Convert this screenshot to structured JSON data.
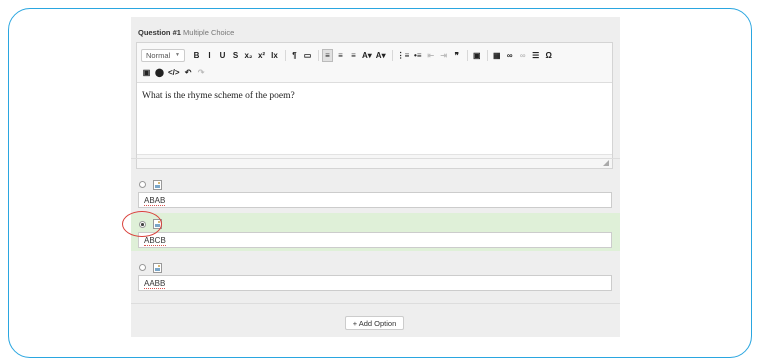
{
  "question": {
    "label": "Question #1",
    "type": "Multiple Choice"
  },
  "toolbar": {
    "format": "Normal",
    "row1": [
      {
        "name": "bold-button",
        "glyph": "B"
      },
      {
        "name": "italic-button",
        "glyph": "I"
      },
      {
        "name": "underline-button",
        "glyph": "U"
      },
      {
        "name": "strikethrough-button",
        "glyph": "S"
      },
      {
        "name": "subscript-button",
        "glyph": "x₂"
      },
      {
        "name": "superscript-button",
        "glyph": "x²"
      },
      {
        "name": "remove-format-button",
        "glyph": "Ix"
      },
      {
        "name": "paragraph-format-button",
        "glyph": "¶"
      },
      {
        "name": "paste-button",
        "glyph": "▭"
      },
      {
        "name": "align-left-button",
        "glyph": "≡",
        "active": true
      },
      {
        "name": "align-center-button",
        "glyph": "≡"
      },
      {
        "name": "align-right-button",
        "glyph": "≡"
      },
      {
        "name": "text-color-button",
        "glyph": "A▾"
      },
      {
        "name": "bg-color-button",
        "glyph": "A▾"
      },
      {
        "name": "numbered-list-button",
        "glyph": "⋮≡"
      },
      {
        "name": "bullet-list-button",
        "glyph": "•≡"
      },
      {
        "name": "outdent-button",
        "glyph": "⇤",
        "dim": true
      },
      {
        "name": "indent-button",
        "glyph": "⇥",
        "dim": true
      },
      {
        "name": "blockquote-button",
        "glyph": "❞"
      },
      {
        "name": "image-button",
        "glyph": "▣"
      },
      {
        "name": "table-button",
        "glyph": "▦"
      },
      {
        "name": "link-button",
        "glyph": "∞"
      },
      {
        "name": "unlink-button",
        "glyph": "∞",
        "dim": true
      },
      {
        "name": "horizontal-rule-button",
        "glyph": "☰"
      },
      {
        "name": "special-char-button",
        "glyph": "Ω"
      }
    ],
    "row2": [
      {
        "name": "media-button",
        "glyph": "▣"
      },
      {
        "name": "circle-button",
        "glyph": "⬤"
      },
      {
        "name": "source-button",
        "glyph": "</>"
      },
      {
        "name": "undo-button",
        "glyph": "↶"
      },
      {
        "name": "redo-button",
        "glyph": "↷",
        "dim": true
      }
    ]
  },
  "editor": {
    "content": "What is the rhyme scheme of the poem?"
  },
  "options": [
    {
      "value": "ABAB",
      "selected": false
    },
    {
      "value": "ABCB",
      "selected": true
    },
    {
      "value": "AABB",
      "selected": false
    }
  ],
  "add_option_label": "+ Add Option",
  "colors": {
    "frame": "#2aa6e0",
    "highlight_ring": "#d9403a",
    "selected_bg": "#dff0d8"
  }
}
